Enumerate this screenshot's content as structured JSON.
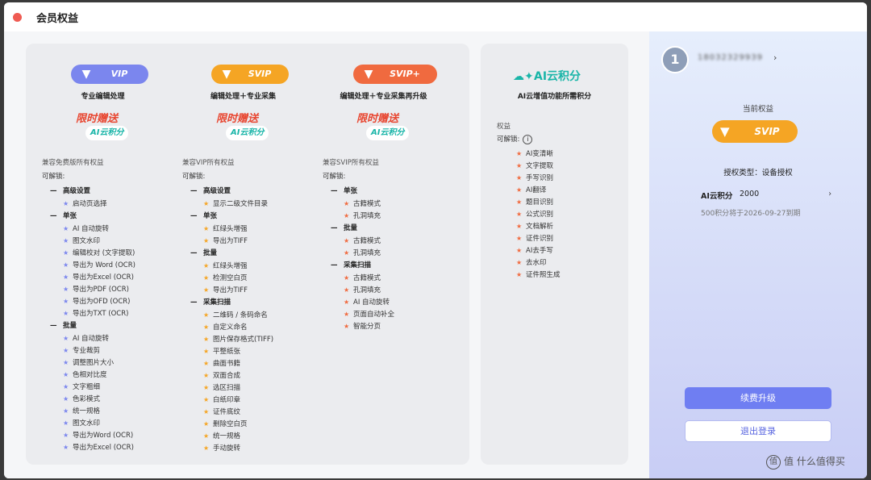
{
  "window": {
    "title": "会员权益"
  },
  "columns": [
    {
      "badge": "VIP",
      "tagline": "专业编辑处理",
      "promo": {
        "line1": "限时赠送",
        "line2": "AI云积分"
      },
      "feature_title": "兼容免费版所有权益",
      "unlock_label": "可解锁:",
      "groups": [
        {
          "title": "高级设置",
          "items": [
            "启动页选择"
          ]
        },
        {
          "title": "单张",
          "items": [
            "AI 自动旋转",
            "图文水印",
            "编辑校对 (文字提取)",
            "导出为 Word (OCR)",
            "导出为Excel (OCR)",
            "导出为PDF (OCR)",
            "导出为OFD (OCR)",
            "导出为TXT (OCR)"
          ]
        },
        {
          "title": "批量",
          "items": [
            "AI 自动旋转",
            "专业裁剪",
            "调整图片大小",
            "色相对比度",
            "文字粗细",
            "色彩模式",
            "统一规格",
            "图文水印",
            "导出为Word (OCR)",
            "导出为Excel (OCR)"
          ]
        }
      ]
    },
    {
      "badge": "SVIP",
      "tagline": "编辑处理＋专业采集",
      "promo": {
        "line1": "限时赠送",
        "line2": "AI云积分"
      },
      "feature_title": "兼容VIP所有权益",
      "unlock_label": "可解锁:",
      "groups": [
        {
          "title": "高级设置",
          "items": [
            "显示二级文件目录"
          ]
        },
        {
          "title": "单张",
          "items": [
            "红绿头增强",
            "导出为TIFF"
          ]
        },
        {
          "title": "批量",
          "items": [
            "红绿头增强",
            "检测空白页",
            "导出为TIFF"
          ]
        },
        {
          "title": "采集扫描",
          "items": [
            "二维码 / 条码命名",
            "自定义命名",
            "图片保存格式(TIFF)",
            "平整纸张",
            "曲面书籍",
            "双面合成",
            "选区扫描",
            "白纸印章",
            "证件底纹",
            "删除空白页",
            "统一规格",
            "手动旋转"
          ]
        }
      ]
    },
    {
      "badge": "SVIP+",
      "tagline": "编辑处理＋专业采集再升级",
      "promo": {
        "line1": "限时赠送",
        "line2": "AI云积分"
      },
      "feature_title": "兼容SVIP所有权益",
      "unlock_label": "可解锁:",
      "groups": [
        {
          "title": "单张",
          "items": [
            "古籍模式",
            "孔洞填充"
          ]
        },
        {
          "title": "批量",
          "items": [
            "古籍模式",
            "孔洞填充"
          ]
        },
        {
          "title": "采集扫描",
          "items": [
            "古籍模式",
            "孔洞填充",
            "AI 自动旋转",
            "页面自动补全",
            "智能分页"
          ]
        }
      ]
    }
  ],
  "ai_panel": {
    "logo": "AI云积分",
    "tagline": "AI云增值功能所需积分",
    "rights_label": "权益",
    "unlock_label": "可解锁:",
    "items": [
      "AI变清晰",
      "文字提取",
      "手写识别",
      "AI翻译",
      "题目识别",
      "公式识别",
      "文档解析",
      "证件识别",
      "AI去手写",
      "去水印",
      "证件照生成"
    ]
  },
  "sidebar": {
    "avatar": "1",
    "account": "18032329939",
    "current_label": "当前权益",
    "current_badge": "SVIP",
    "auth_type": "授权类型：设备授权",
    "ai_points_label": "AI云积分",
    "ai_points_value": "2000",
    "expiry": "500积分将于2026-09-27到期",
    "renew_button": "续费升级",
    "logout_button": "退出登录"
  },
  "watermark": {
    "text": "值 什么值得买"
  },
  "colors": {
    "vip": "#7b86ee",
    "svip": "#f5a524",
    "svip_plus": "#f06a3f",
    "ai_teal": "#19b5a8",
    "primary": "#6f7ef2"
  }
}
